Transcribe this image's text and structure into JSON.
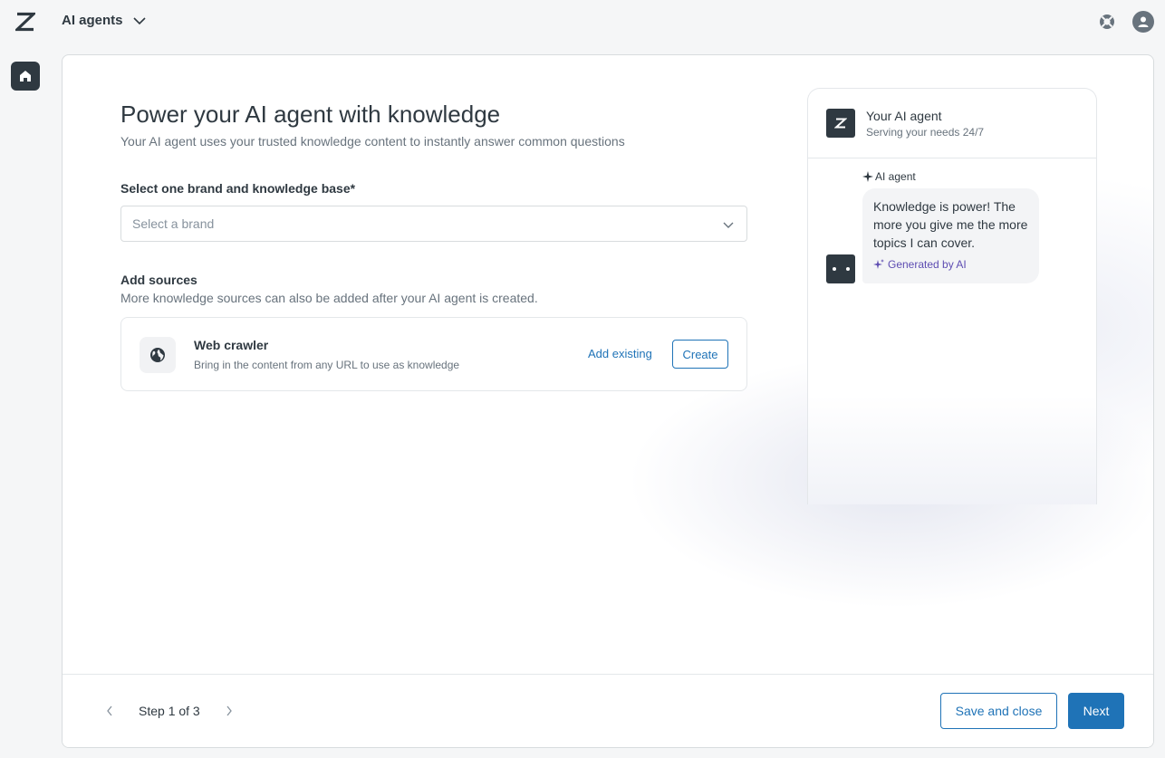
{
  "header": {
    "product_name": "AI agents",
    "icons": [
      "zendesk-logo",
      "chevron-down-icon",
      "help-icon",
      "user-avatar-icon"
    ]
  },
  "nav": {
    "items": [
      {
        "icon": "home-icon",
        "active": true
      }
    ]
  },
  "page": {
    "title": "Power your AI agent with knowledge",
    "subtitle": "Your AI agent uses your trusted knowledge content to instantly answer common questions"
  },
  "brand_select": {
    "label": "Select one brand and knowledge base*",
    "placeholder": "Select a brand"
  },
  "sources": {
    "title": "Add sources",
    "subtitle": "More knowledge sources can also be added after your AI agent is created.",
    "items": [
      {
        "name": "Web crawler",
        "description": "Bring in the content from any URL to use as knowledge",
        "icon": "globe-icon",
        "add_existing_label": "Add existing",
        "create_label": "Create"
      }
    ]
  },
  "preview": {
    "agent_name": "Your AI agent",
    "tagline": "Serving your needs 24/7",
    "sender_label": "AI agent",
    "message": "Knowledge is power! The more you give me the more topics I can cover.",
    "generated_label": "Generated by AI"
  },
  "footer": {
    "step_text": "Step 1 of 3",
    "save_label": "Save and close",
    "next_label": "Next"
  },
  "colors": {
    "accent": "#1f73b7",
    "dark": "#2f3941",
    "ai_purple": "#5e4db2"
  }
}
